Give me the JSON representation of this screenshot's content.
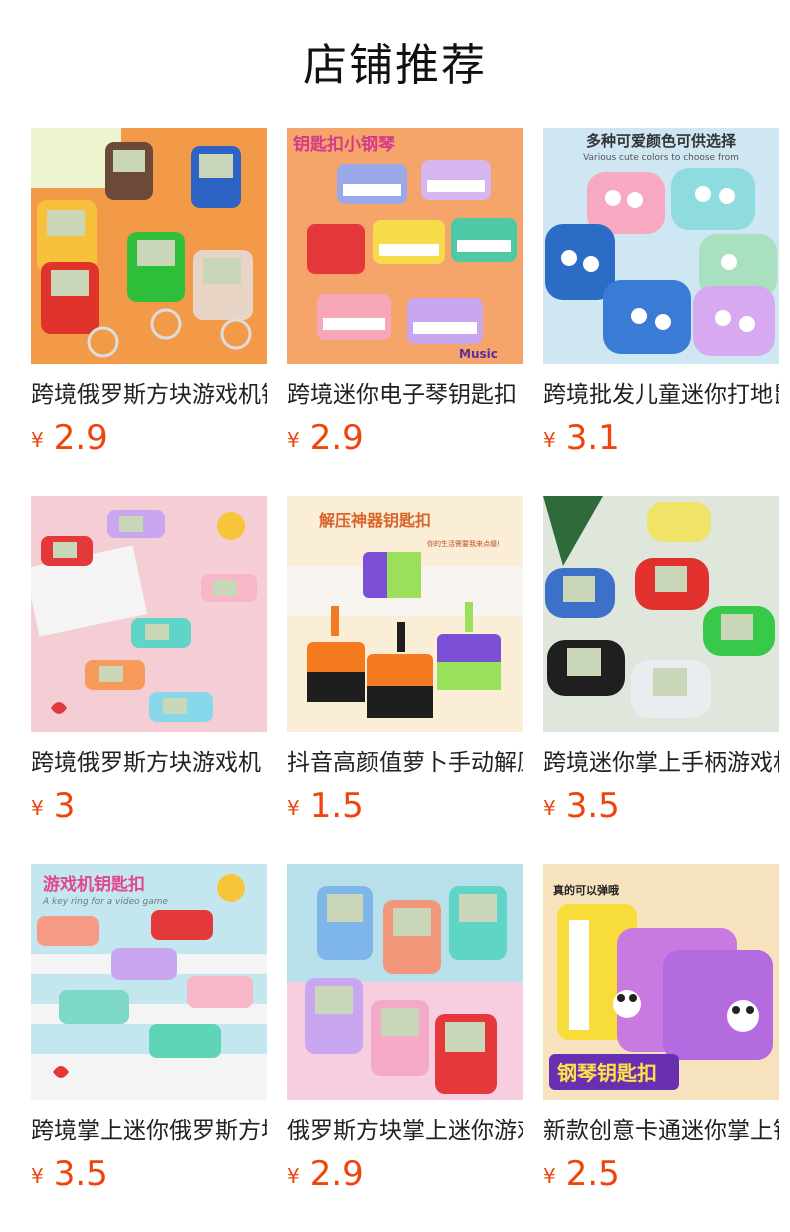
{
  "section": {
    "title": "店铺推荐"
  },
  "currency_symbol": "¥",
  "products": [
    {
      "name": "跨境俄罗斯方块游戏机钥匙扣",
      "price": "2.9",
      "image": {
        "overlay_text": "",
        "overlay_sub": "",
        "colors": [
          "#f08a3c",
          "#f7b06a"
        ]
      }
    },
    {
      "name": "跨境迷你电子琴钥匙扣",
      "price": "2.9",
      "image": {
        "overlay_text": "钥匙扣小钢琴",
        "overlay_sub": "Music",
        "colors": [
          "#f4a46a",
          "#f7c08a"
        ]
      }
    },
    {
      "name": "跨境批发儿童迷你打地鼠",
      "price": "3.1",
      "image": {
        "overlay_text": "多种可爱颜色可供选择",
        "overlay_sub": "Various cute colors to choose from",
        "colors": [
          "#bcdff0",
          "#e8f3fa"
        ]
      }
    },
    {
      "name": "跨境俄罗斯方块游戏机",
      "price": "3",
      "image": {
        "overlay_text": "",
        "overlay_sub": "",
        "colors": [
          "#f2c7cf",
          "#f8dfe4"
        ]
      }
    },
    {
      "name": "抖音高颜值萝卜手动解压",
      "price": "1.5",
      "image": {
        "overlay_text": "解压神器钥匙扣",
        "overlay_sub": "你的生活需要我来点缀!",
        "colors": [
          "#f7e6c7",
          "#fbf1de"
        ]
      }
    },
    {
      "name": "跨境迷你掌上手柄游戏机",
      "price": "3.5",
      "image": {
        "overlay_text": "",
        "overlay_sub": "",
        "colors": [
          "#c9d6c8",
          "#e6ede2"
        ]
      }
    },
    {
      "name": "跨境掌上迷你俄罗斯方块",
      "price": "3.5",
      "image": {
        "overlay_text": "游戏机钥匙扣",
        "overlay_sub": "A key ring for a video game",
        "colors": [
          "#bfe5ee",
          "#e1f3f6"
        ]
      }
    },
    {
      "name": "俄罗斯方块掌上迷你游戏机",
      "price": "2.9",
      "image": {
        "overlay_text": "",
        "overlay_sub": "",
        "colors": [
          "#b9e2ec",
          "#f7cfe0"
        ]
      }
    },
    {
      "name": "新款创意卡通迷你掌上钢琴",
      "price": "2.5",
      "image": {
        "overlay_text": "钢琴钥匙扣",
        "overlay_sub": "真的可以弹哦",
        "colors": [
          "#f3d9a9",
          "#f9ead0"
        ]
      }
    }
  ]
}
